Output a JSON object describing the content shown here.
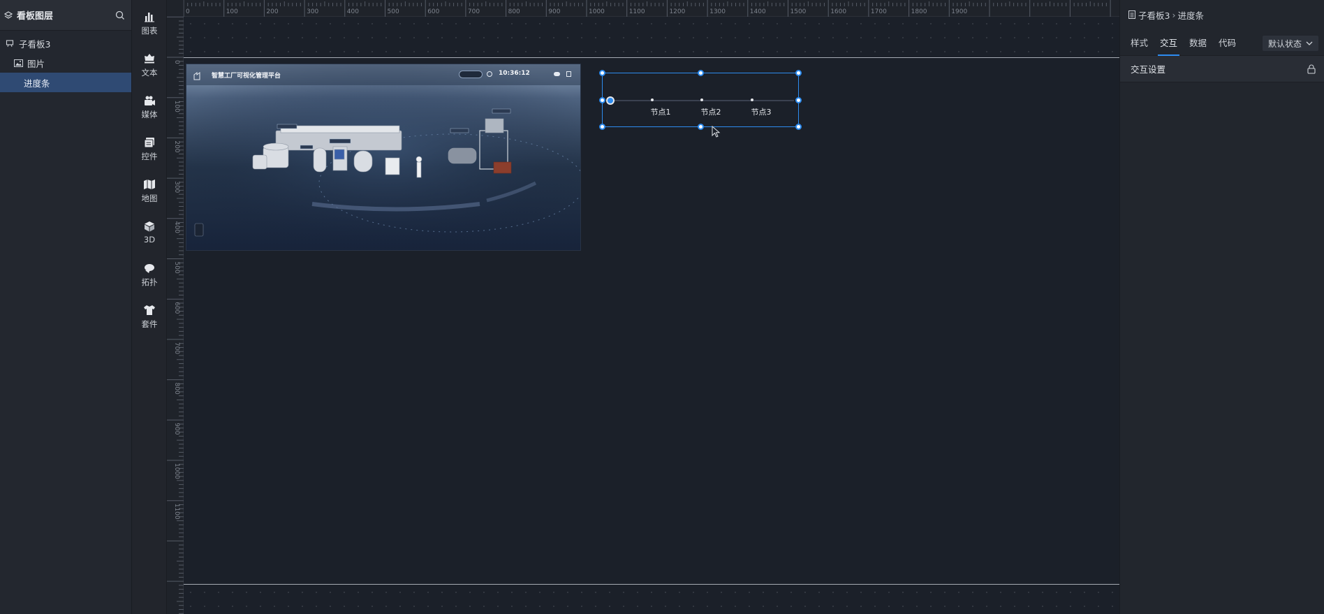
{
  "layers": {
    "title": "看板图层",
    "items": [
      {
        "label": "子看板3",
        "level": 0,
        "icon": "board-icon"
      },
      {
        "label": "图片",
        "level": 1,
        "icon": "image-icon"
      },
      {
        "label": "进度条",
        "level": 2,
        "icon": "",
        "selected": true
      }
    ]
  },
  "toolbar": {
    "items": [
      {
        "label": "图表",
        "icon": "bar-chart-icon"
      },
      {
        "label": "文本",
        "icon": "text-icon"
      },
      {
        "label": "媒体",
        "icon": "media-icon"
      },
      {
        "label": "控件",
        "icon": "control-icon"
      },
      {
        "label": "地图",
        "icon": "map-icon"
      },
      {
        "label": "3D",
        "icon": "cube-icon"
      },
      {
        "label": "拓扑",
        "icon": "topology-icon"
      },
      {
        "label": "套件",
        "icon": "kit-icon"
      }
    ]
  },
  "ruler": {
    "top_ticks": [
      "0",
      "100",
      "200",
      "300",
      "400",
      "500",
      "600",
      "700",
      "800",
      "900",
      "1000",
      "1100",
      "1200",
      "1300",
      "1400",
      "1500",
      "1600",
      "1700",
      "1800",
      "1900"
    ],
    "left_ticks": [
      "0",
      "100",
      "200",
      "300",
      "400",
      "500",
      "600",
      "700",
      "800",
      "900",
      "1000",
      "1100"
    ]
  },
  "canvas_image": {
    "title": "智慧工厂可视化管理平台",
    "tag": "",
    "time": "10:36:12",
    "floating_labels": [
      "",
      "",
      "",
      "",
      ""
    ]
  },
  "progress_bar": {
    "nodes": [
      "节点1",
      "节点2",
      "节点3"
    ]
  },
  "props": {
    "breadcrumb": [
      "子看板3",
      "进度条"
    ],
    "tabs": [
      "样式",
      "交互",
      "数据",
      "代码"
    ],
    "active_tab": "交互",
    "state_label": "默认状态",
    "section_title": "交互设置"
  },
  "colors": {
    "accent": "#2d8cf0",
    "selected_row": "#2f4a73",
    "canvas_bg": "#1b2029"
  }
}
